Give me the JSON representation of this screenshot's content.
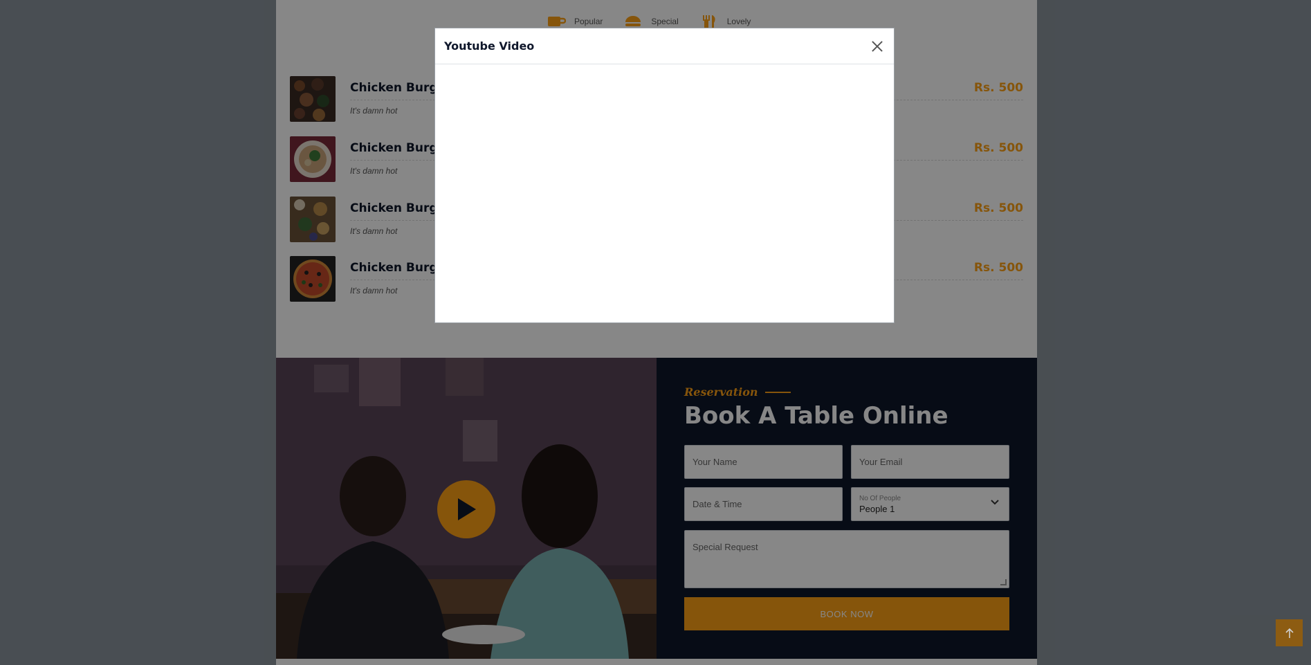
{
  "menu": {
    "tabs": [
      {
        "label": "Popular",
        "icon": "coffee-icon"
      },
      {
        "label": "Special",
        "icon": "hamburger-icon"
      },
      {
        "label": "Lovely",
        "icon": "utensils-icon"
      }
    ],
    "items": [
      {
        "name": "Chicken Burger",
        "price": "Rs. 500",
        "desc": "It's damn hot"
      },
      {
        "name": "Chicken Burger",
        "price": "Rs. 500",
        "desc": "It's damn hot"
      },
      {
        "name": "Chicken Burger",
        "price": "Rs. 500",
        "desc": "It's damn hot"
      },
      {
        "name": "Chicken Burger",
        "price": "Rs. 500",
        "desc": "It's damn hot"
      }
    ]
  },
  "reservation": {
    "eyebrow": "Reservation",
    "title": "Book A Table Online",
    "name_placeholder": "Your Name",
    "email_placeholder": "Your Email",
    "datetime_placeholder": "Date & Time",
    "people_label": "No Of People",
    "people_value": "People 1",
    "request_placeholder": "Special Request",
    "submit_label": "BOOK NOW"
  },
  "modal": {
    "title": "Youtube Video"
  },
  "colors": {
    "accent": "#fea116",
    "dark": "#0f172b"
  }
}
